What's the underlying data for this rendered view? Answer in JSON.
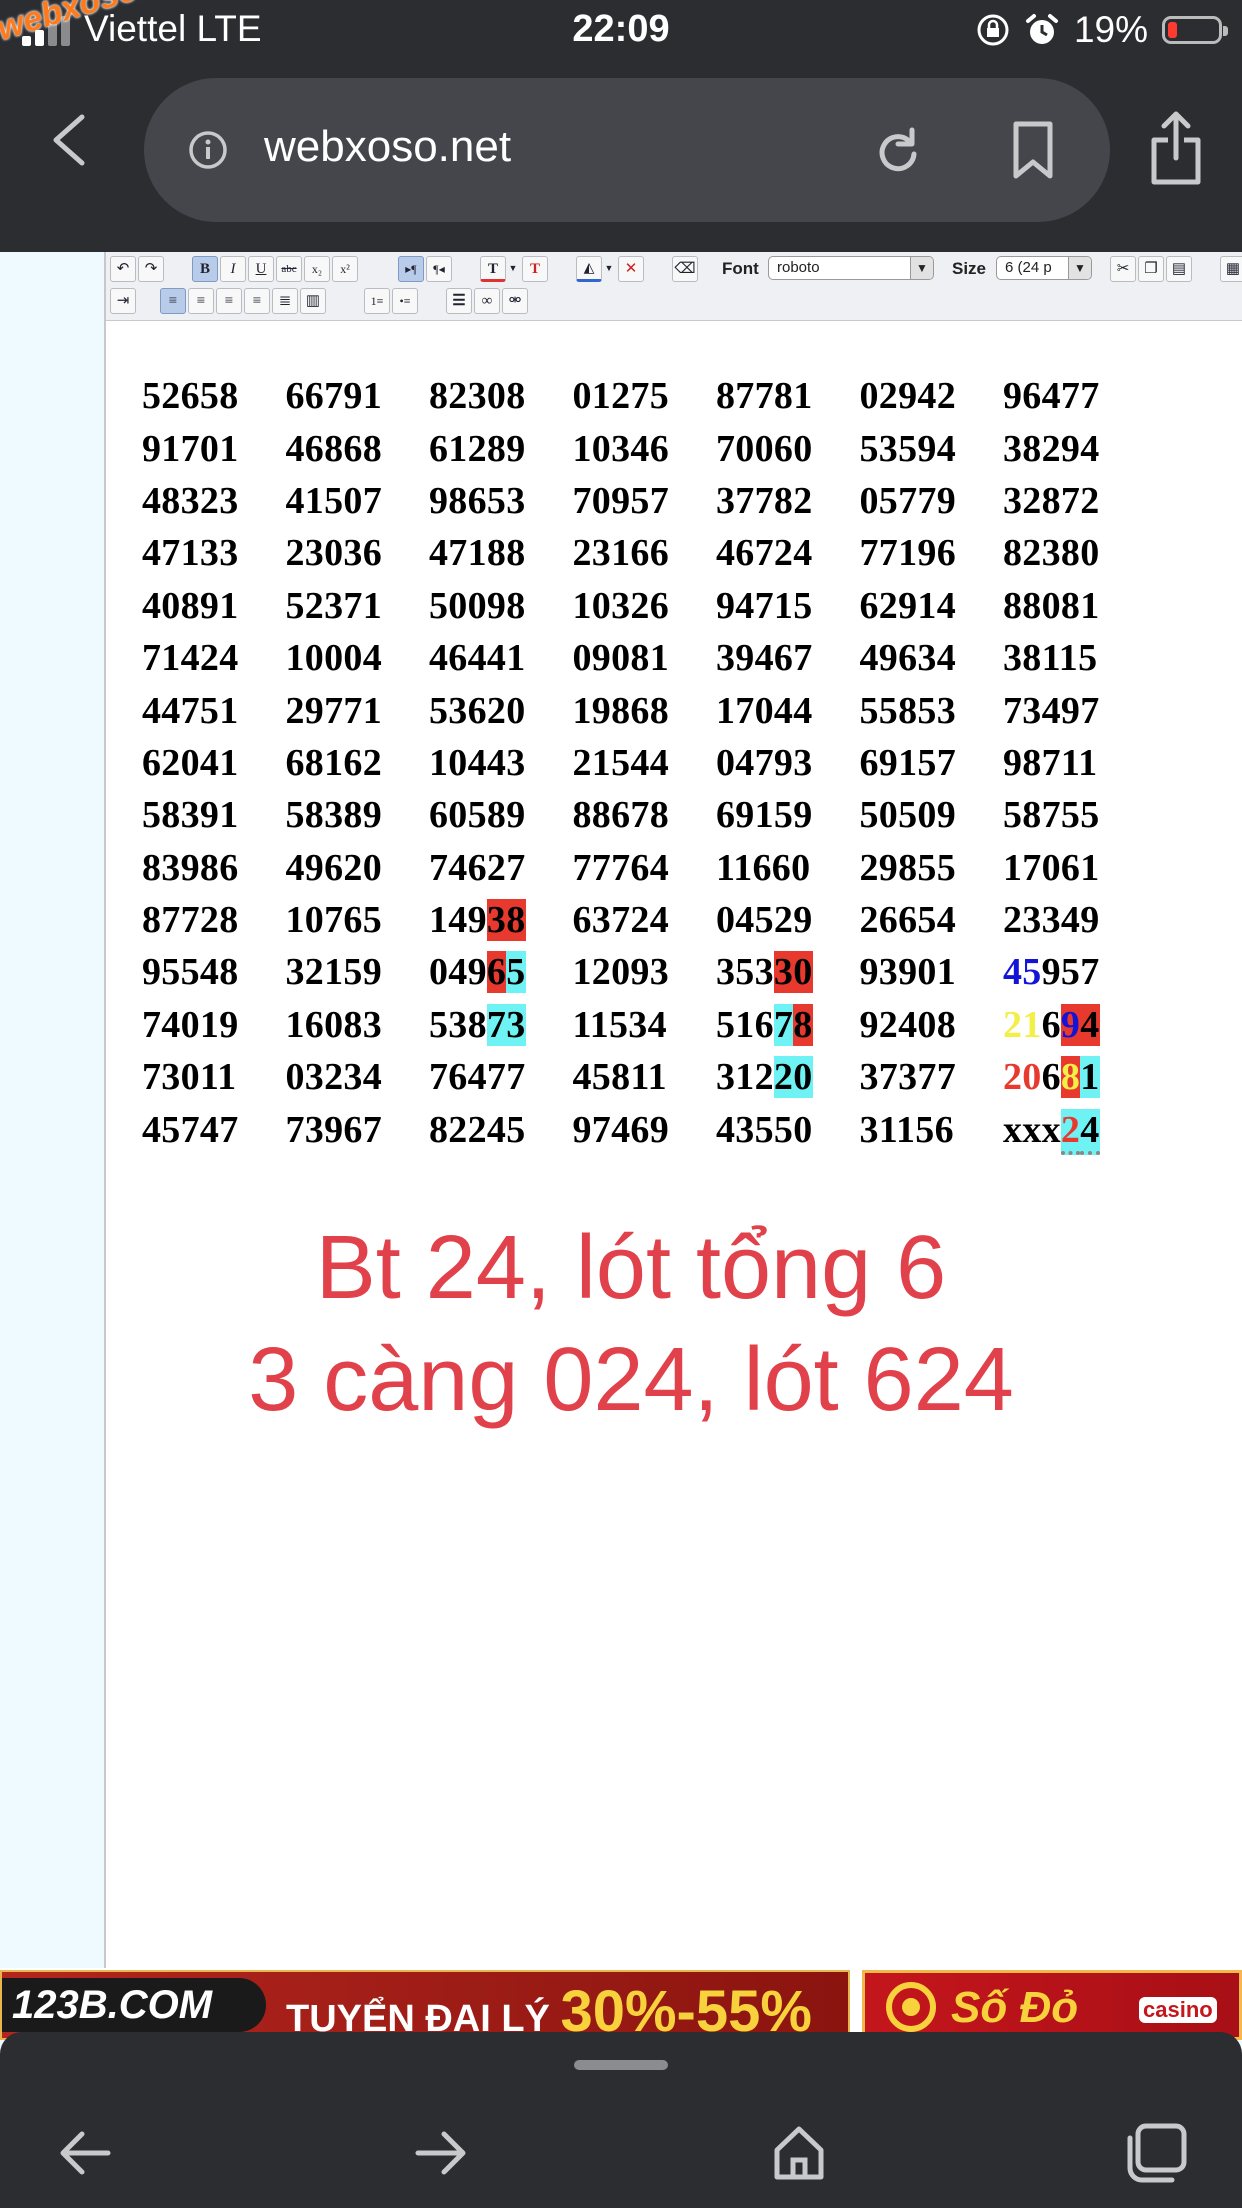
{
  "status_bar": {
    "carrier": "Viettel",
    "network": "LTE",
    "time": "22:09",
    "battery_percent": "19%",
    "battery_level": 0.19,
    "watermark": "webxoso.net"
  },
  "browser": {
    "url": "webxoso.net",
    "icons": [
      "back-icon",
      "info-icon",
      "reload-icon",
      "bookmark-icon",
      "share-icon"
    ]
  },
  "toolbar": {
    "font_label": "Font",
    "font_value": "roboto",
    "size_label": "Size",
    "size_value": "6 (24 p"
  },
  "numbers": [
    [
      [
        {
          "t": "52658"
        }
      ],
      [
        {
          "t": "66791"
        }
      ],
      [
        {
          "t": "82308"
        }
      ],
      [
        {
          "t": "01275"
        }
      ],
      [
        {
          "t": "87781"
        }
      ],
      [
        {
          "t": "02942"
        }
      ],
      [
        {
          "t": "96477"
        }
      ]
    ],
    [
      [
        {
          "t": "91701"
        }
      ],
      [
        {
          "t": "46868"
        }
      ],
      [
        {
          "t": "61289"
        }
      ],
      [
        {
          "t": "10346"
        }
      ],
      [
        {
          "t": "70060"
        }
      ],
      [
        {
          "t": "53594"
        }
      ],
      [
        {
          "t": "38294"
        }
      ]
    ],
    [
      [
        {
          "t": "48323"
        }
      ],
      [
        {
          "t": "41507"
        }
      ],
      [
        {
          "t": "98653"
        }
      ],
      [
        {
          "t": "70957"
        }
      ],
      [
        {
          "t": "37782"
        }
      ],
      [
        {
          "t": "05779"
        }
      ],
      [
        {
          "t": "32872"
        }
      ]
    ],
    [
      [
        {
          "t": "47133"
        }
      ],
      [
        {
          "t": "23036"
        }
      ],
      [
        {
          "t": "47188"
        }
      ],
      [
        {
          "t": "23166"
        }
      ],
      [
        {
          "t": "46724"
        }
      ],
      [
        {
          "t": "77196"
        }
      ],
      [
        {
          "t": "82380"
        }
      ]
    ],
    [
      [
        {
          "t": "40891"
        }
      ],
      [
        {
          "t": "52371"
        }
      ],
      [
        {
          "t": "50098"
        }
      ],
      [
        {
          "t": "10326"
        }
      ],
      [
        {
          "t": "94715"
        }
      ],
      [
        {
          "t": "62914"
        }
      ],
      [
        {
          "t": "88081"
        }
      ]
    ],
    [
      [
        {
          "t": "71424"
        }
      ],
      [
        {
          "t": "10004"
        }
      ],
      [
        {
          "t": "46441"
        }
      ],
      [
        {
          "t": "09081"
        }
      ],
      [
        {
          "t": "39467"
        }
      ],
      [
        {
          "t": "49634"
        }
      ],
      [
        {
          "t": "38115"
        }
      ]
    ],
    [
      [
        {
          "t": "44751"
        }
      ],
      [
        {
          "t": "29771"
        }
      ],
      [
        {
          "t": "53620"
        }
      ],
      [
        {
          "t": "19868"
        }
      ],
      [
        {
          "t": "17044"
        }
      ],
      [
        {
          "t": "55853"
        }
      ],
      [
        {
          "t": "73497"
        }
      ]
    ],
    [
      [
        {
          "t": "62041"
        }
      ],
      [
        {
          "t": "68162"
        }
      ],
      [
        {
          "t": "10443"
        }
      ],
      [
        {
          "t": "21544"
        }
      ],
      [
        {
          "t": "04793"
        }
      ],
      [
        {
          "t": "69157"
        }
      ],
      [
        {
          "t": "98711"
        }
      ]
    ],
    [
      [
        {
          "t": "58391"
        }
      ],
      [
        {
          "t": "58389"
        }
      ],
      [
        {
          "t": "60589"
        }
      ],
      [
        {
          "t": "88678"
        }
      ],
      [
        {
          "t": "69159"
        }
      ],
      [
        {
          "t": "50509"
        }
      ],
      [
        {
          "t": "58755"
        }
      ]
    ],
    [
      [
        {
          "t": "83986"
        }
      ],
      [
        {
          "t": "49620"
        }
      ],
      [
        {
          "t": "74627"
        }
      ],
      [
        {
          "t": "77764"
        }
      ],
      [
        {
          "t": "11660"
        }
      ],
      [
        {
          "t": "29855"
        }
      ],
      [
        {
          "t": "17061"
        }
      ]
    ],
    [
      [
        {
          "t": "87728"
        }
      ],
      [
        {
          "t": "10765"
        }
      ],
      [
        {
          "t": "149"
        },
        {
          "t": "38",
          "bg": "#e8392e"
        }
      ],
      [
        {
          "t": "63724"
        }
      ],
      [
        {
          "t": "04529"
        }
      ],
      [
        {
          "t": "26654"
        }
      ],
      [
        {
          "t": "23349"
        }
      ]
    ],
    [
      [
        {
          "t": "95548"
        }
      ],
      [
        {
          "t": "32159"
        }
      ],
      [
        {
          "t": "049"
        },
        {
          "t": "6",
          "bg": "#e8392e"
        },
        {
          "t": "5",
          "bg": "#6ef2f4"
        }
      ],
      [
        {
          "t": "12093"
        }
      ],
      [
        {
          "t": "353"
        },
        {
          "t": "30",
          "bg": "#e8392e"
        }
      ],
      [
        {
          "t": "93901"
        }
      ],
      [
        {
          "t": "45",
          "color": "#1414d6"
        },
        {
          "t": "957"
        }
      ]
    ],
    [
      [
        {
          "t": "74019"
        }
      ],
      [
        {
          "t": "16083"
        }
      ],
      [
        {
          "t": "538"
        },
        {
          "t": "73",
          "bg": "#6ef2f4"
        }
      ],
      [
        {
          "t": "11534"
        }
      ],
      [
        {
          "t": "516"
        },
        {
          "t": "7",
          "bg": "#6ef2f4"
        },
        {
          "t": "8",
          "bg": "#e8392e"
        }
      ],
      [
        {
          "t": "92408"
        }
      ],
      [
        {
          "t": "21",
          "color": "#f2ef47"
        },
        {
          "t": "6"
        },
        {
          "t": "9",
          "color": "#1414d6",
          "bg": "#e8392e"
        },
        {
          "t": "4",
          "bg": "#e8392e"
        }
      ]
    ],
    [
      [
        {
          "t": "73011"
        }
      ],
      [
        {
          "t": "03234"
        }
      ],
      [
        {
          "t": "76477"
        }
      ],
      [
        {
          "t": "45811"
        }
      ],
      [
        {
          "t": "312"
        },
        {
          "t": "20",
          "bg": "#6ef2f4"
        }
      ],
      [
        {
          "t": "37377"
        }
      ],
      [
        {
          "t": "20",
          "color": "#e8392e"
        },
        {
          "t": "6"
        },
        {
          "t": "8",
          "color": "#f2ef47",
          "bg": "#e8392e"
        },
        {
          "t": "1",
          "bg": "#6ef2f4"
        }
      ]
    ],
    [
      [
        {
          "t": "45747"
        }
      ],
      [
        {
          "t": "73967"
        }
      ],
      [
        {
          "t": "82245"
        }
      ],
      [
        {
          "t": "97469"
        }
      ],
      [
        {
          "t": "43550"
        }
      ],
      [
        {
          "t": "31156"
        }
      ],
      [
        {
          "t": "xxx"
        },
        {
          "t": "2",
          "color": "#e8392e",
          "bg": "#6ef2f4",
          "dots": true
        },
        {
          "t": "4",
          "bg": "#6ef2f4",
          "dots": true
        }
      ]
    ]
  ],
  "note": {
    "line1": "Bt 24, lót tổng 6",
    "line2": "3 càng 024, lót 624",
    "color": "#e0414a"
  },
  "ads": {
    "ad1_logo": "123B.COM",
    "ad1_text": "TUYỂN ĐẠI LÝ",
    "ad1_big": "30%-55%",
    "ad2_text": "Số Đỏ",
    "ad2_badge": "casino"
  },
  "colors": {
    "chrome_bg": "#2c2d31",
    "highlight_red": "#e8392e",
    "highlight_cyan": "#6ef2f4"
  }
}
